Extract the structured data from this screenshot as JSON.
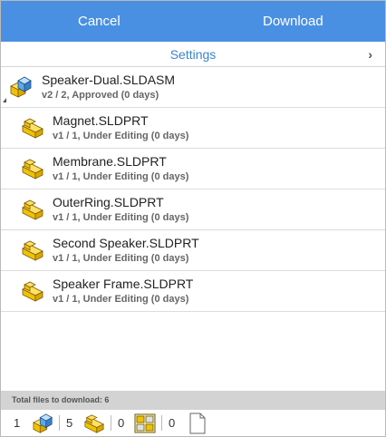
{
  "toolbar": {
    "cancel_label": "Cancel",
    "download_label": "Download"
  },
  "settings": {
    "label": "Settings",
    "chevron": "›"
  },
  "items": [
    {
      "name": "Speaker-Dual.SLDASM",
      "meta": "v2 / 2, Approved (0 days)",
      "icon": "assembly-icon"
    },
    {
      "name": "Magnet.SLDPRT",
      "meta": "v1 / 1, Under Editing (0 days)",
      "icon": "part-icon"
    },
    {
      "name": "Membrane.SLDPRT",
      "meta": "v1 / 1, Under Editing (0 days)",
      "icon": "part-icon"
    },
    {
      "name": "OuterRing.SLDPRT",
      "meta": "v1 / 1, Under Editing (0 days)",
      "icon": "part-icon"
    },
    {
      "name": "Second Speaker.SLDPRT",
      "meta": "v1 / 1, Under Editing (0 days)",
      "icon": "part-icon"
    },
    {
      "name": "Speaker Frame.SLDPRT",
      "meta": "v1 / 1, Under Editing (0 days)",
      "icon": "part-icon"
    }
  ],
  "footer": {
    "total_label": "Total files to download: 6",
    "counts": [
      {
        "value": "1",
        "icon": "assembly-icon"
      },
      {
        "value": "5",
        "icon": "part-icon"
      },
      {
        "value": "0",
        "icon": "drawing-icon"
      },
      {
        "value": "0",
        "icon": "document-icon"
      }
    ]
  },
  "colors": {
    "accent": "#4a90e2",
    "link": "#3a86cf",
    "part_yellow": "#f2c200",
    "assembly_blue": "#5fa8e8"
  }
}
